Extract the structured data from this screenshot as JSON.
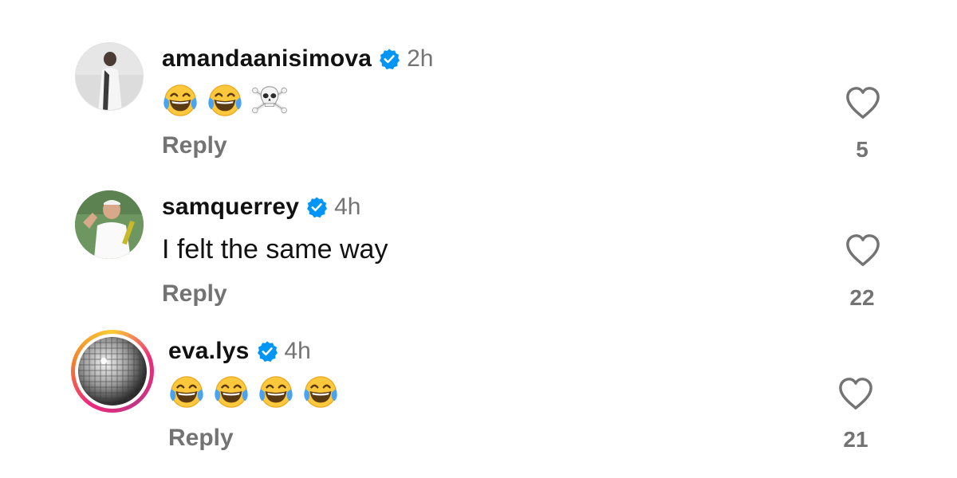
{
  "comments": [
    {
      "username": "amandaanisimova",
      "verified": true,
      "time": "2h",
      "emojis": [
        "face-with-tears-of-joy",
        "face-with-tears-of-joy",
        "skull-and-crossbones"
      ],
      "reply_label": "Reply",
      "likes": "5"
    },
    {
      "username": "samquerrey",
      "verified": true,
      "time": "4h",
      "text": "I felt the same way",
      "reply_label": "Reply",
      "likes": "22"
    },
    {
      "username": "eva.lys",
      "verified": true,
      "time": "4h",
      "emojis": [
        "face-with-tears-of-joy",
        "face-with-tears-of-joy",
        "face-with-tears-of-joy",
        "face-with-tears-of-joy"
      ],
      "reply_label": "Reply",
      "likes": "21",
      "has_story_ring": true
    }
  ],
  "icons": {
    "verified": "verified-badge-icon",
    "like": "heart-outline-icon"
  },
  "colors": {
    "verified_blue": "#0095f6",
    "secondary_text": "#737373",
    "primary_text": "#111111"
  }
}
